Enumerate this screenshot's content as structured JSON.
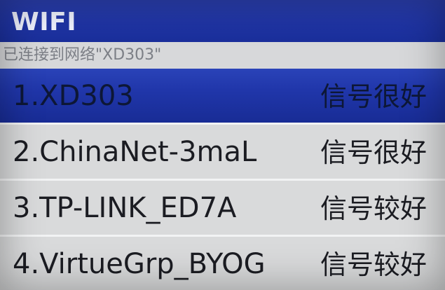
{
  "header": {
    "title": "WIFI"
  },
  "status": {
    "text": "已连接到网络\"XD303\""
  },
  "colors": {
    "titlebar": "#1f34a5",
    "selected_row": "#2036aa",
    "row": "#d9dadb",
    "divider": "#f2f3f4",
    "text": "#1b1c22"
  },
  "networks": [
    {
      "label": "1.XD303",
      "signal": "信号很好",
      "selected": true
    },
    {
      "label": "2.ChinaNet-3maL",
      "signal": "信号很好",
      "selected": false
    },
    {
      "label": "3.TP-LINK_ED7A",
      "signal": "信号较好",
      "selected": false
    },
    {
      "label": "4.VirtueGrp_BYOG",
      "signal": "信号较好",
      "selected": false
    }
  ]
}
